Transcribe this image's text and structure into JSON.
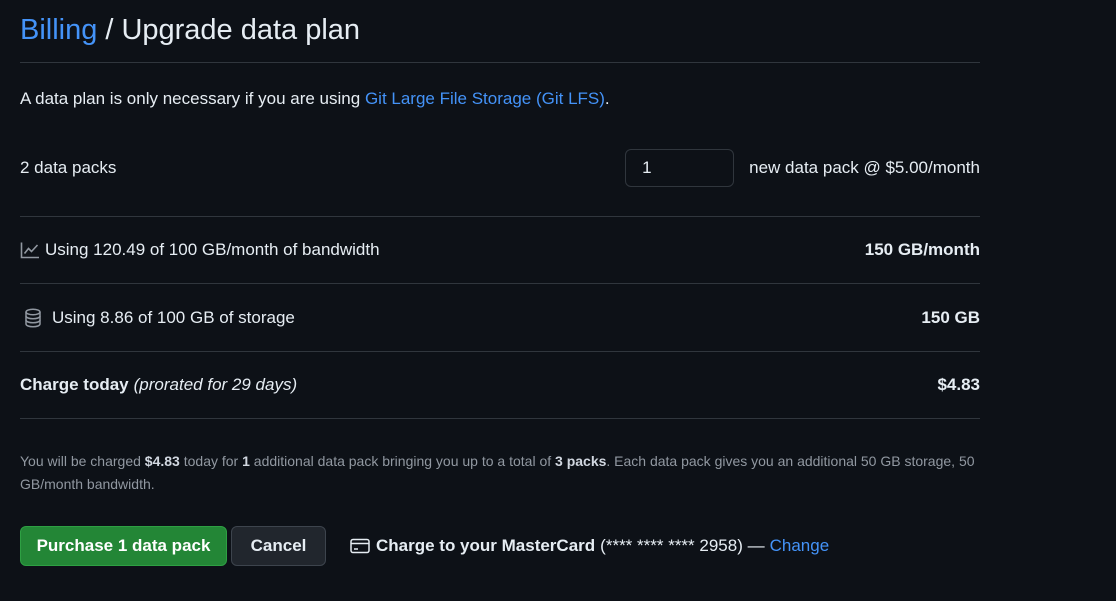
{
  "header": {
    "breadcrumb_link": "Billing",
    "separator": "/",
    "title": "Upgrade data plan"
  },
  "intro": {
    "text": "A data plan is only necessary if you are using ",
    "link": "Git Large File Storage (Git LFS)",
    "suffix": "."
  },
  "packs": {
    "current": "2 data packs",
    "quantity_value": "1",
    "unit_price": "new data pack @ $5.00/month"
  },
  "bandwidth": {
    "icon": "graph-icon",
    "text": "Using 120.49 of 100 GB/month of bandwidth",
    "new_total": "150 GB/month"
  },
  "storage": {
    "icon": "database-icon",
    "text": "Using 8.86 of 100 GB of storage",
    "new_total": "150 GB"
  },
  "charge": {
    "label": "Charge today",
    "note": "(prorated for 29 days)",
    "amount": "$4.83"
  },
  "summary": {
    "p1": "You will be charged ",
    "amount": "$4.83",
    "p2": " today for ",
    "count": "1",
    "p3": " additional data pack bringing you up to a total of ",
    "total": "3 packs",
    "p4": ". Each data pack gives you an additional 50 GB storage, 50 GB/month bandwidth."
  },
  "actions": {
    "purchase_label": "Purchase 1 data pack",
    "cancel_label": "Cancel"
  },
  "payment": {
    "icon": "credit-card-icon",
    "label": "Charge to your MasterCard",
    "card": "(**** **** **** 2958) — ",
    "change_link": "Change"
  },
  "colors": {
    "background": "#0d1117",
    "link": "#4493f8",
    "primary_button": "#238636",
    "border": "#30363d"
  }
}
